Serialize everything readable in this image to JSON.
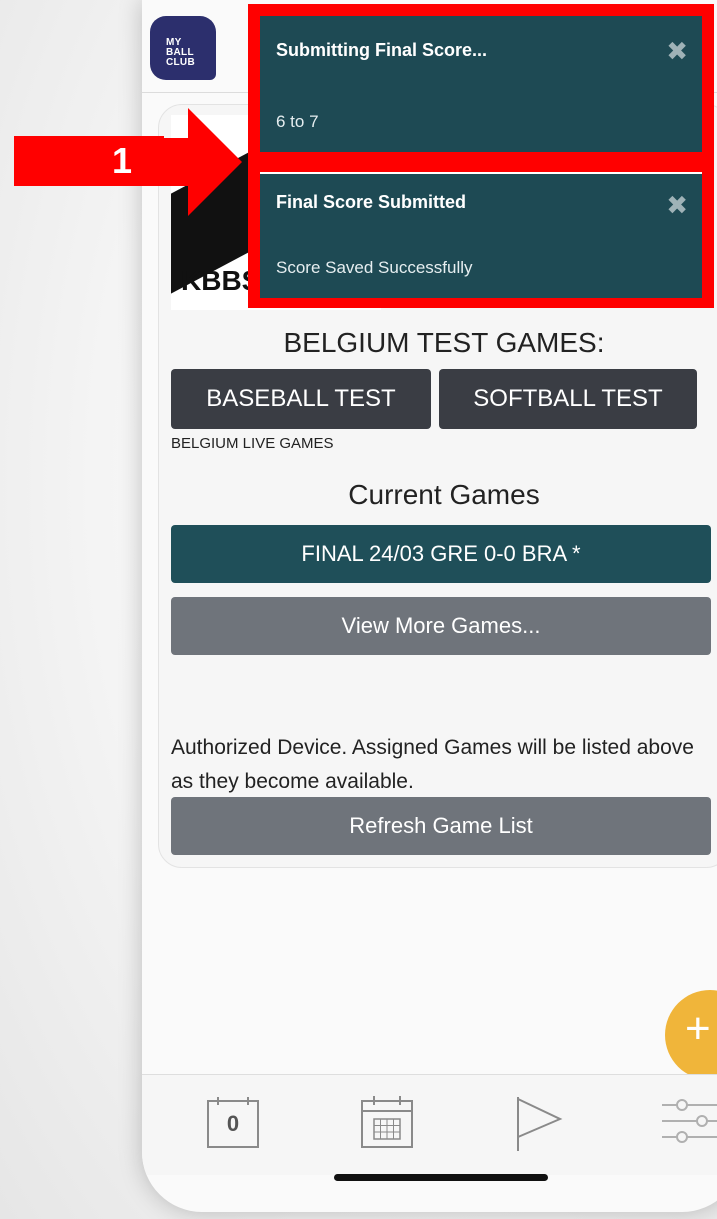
{
  "app": {
    "logo_text": "MY\nBALL\nCLUB"
  },
  "notifications": [
    {
      "title": "Submitting Final Score...",
      "message": "6 to 7"
    },
    {
      "title": "Final Score Submitted",
      "message": "Score Saved Successfully"
    }
  ],
  "annotation": {
    "step": "1"
  },
  "logo": {
    "text": "KBBSF"
  },
  "test_games": {
    "title": "BELGIUM TEST GAMES:",
    "baseball_label": "BASEBALL TEST",
    "softball_label": "SOFTBALL TEST"
  },
  "live_games_label": "BELGIUM LIVE GAMES",
  "current_games": {
    "title": "Current Games",
    "items": [
      "FINAL 24/03 GRE 0-0 BRA *"
    ],
    "view_more": "View More Games..."
  },
  "authorized_text": "Authorized Device. Assigned Games will be listed above as they become available.",
  "refresh_label": "Refresh Game List",
  "tabbar": {
    "calendar_day": "0"
  },
  "colors": {
    "accent": "#1f4f59",
    "toast": "#1e4a54",
    "highlight": "#ff0000",
    "fab": "#f0b53a"
  }
}
